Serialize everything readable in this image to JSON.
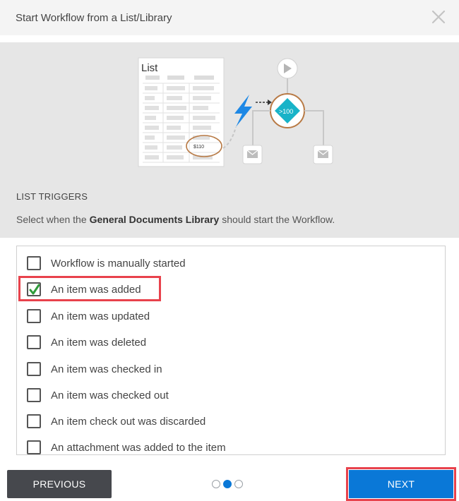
{
  "header": {
    "title": "Start Workflow from a List/Library"
  },
  "illustration": {
    "list_title": "List",
    "highlight_value": "$110",
    "condition": ">100"
  },
  "triggers": {
    "title": "LIST TRIGGERS",
    "desc_before": "Select when the",
    "library_name": "General Documents Library",
    "desc_after": "should start the Workflow.",
    "options": [
      {
        "label": "Workflow is manually started",
        "checked": false
      },
      {
        "label": "An item was added",
        "checked": true
      },
      {
        "label": "An item was updated",
        "checked": false
      },
      {
        "label": "An item was deleted",
        "checked": false
      },
      {
        "label": "An item was checked in",
        "checked": false
      },
      {
        "label": "An item was checked out",
        "checked": false
      },
      {
        "label": "An item check out was discarded",
        "checked": false
      },
      {
        "label": "An attachment was added to the item",
        "checked": false
      }
    ]
  },
  "footer": {
    "previous_label": "PREVIOUS",
    "next_label": "NEXT",
    "step_current": 2,
    "step_total": 3
  },
  "colors": {
    "accent": "#0a78d7",
    "highlight": "#e8424c",
    "check": "#2e9c3a",
    "teal": "#18b3c8",
    "ring": "#b87a45"
  }
}
